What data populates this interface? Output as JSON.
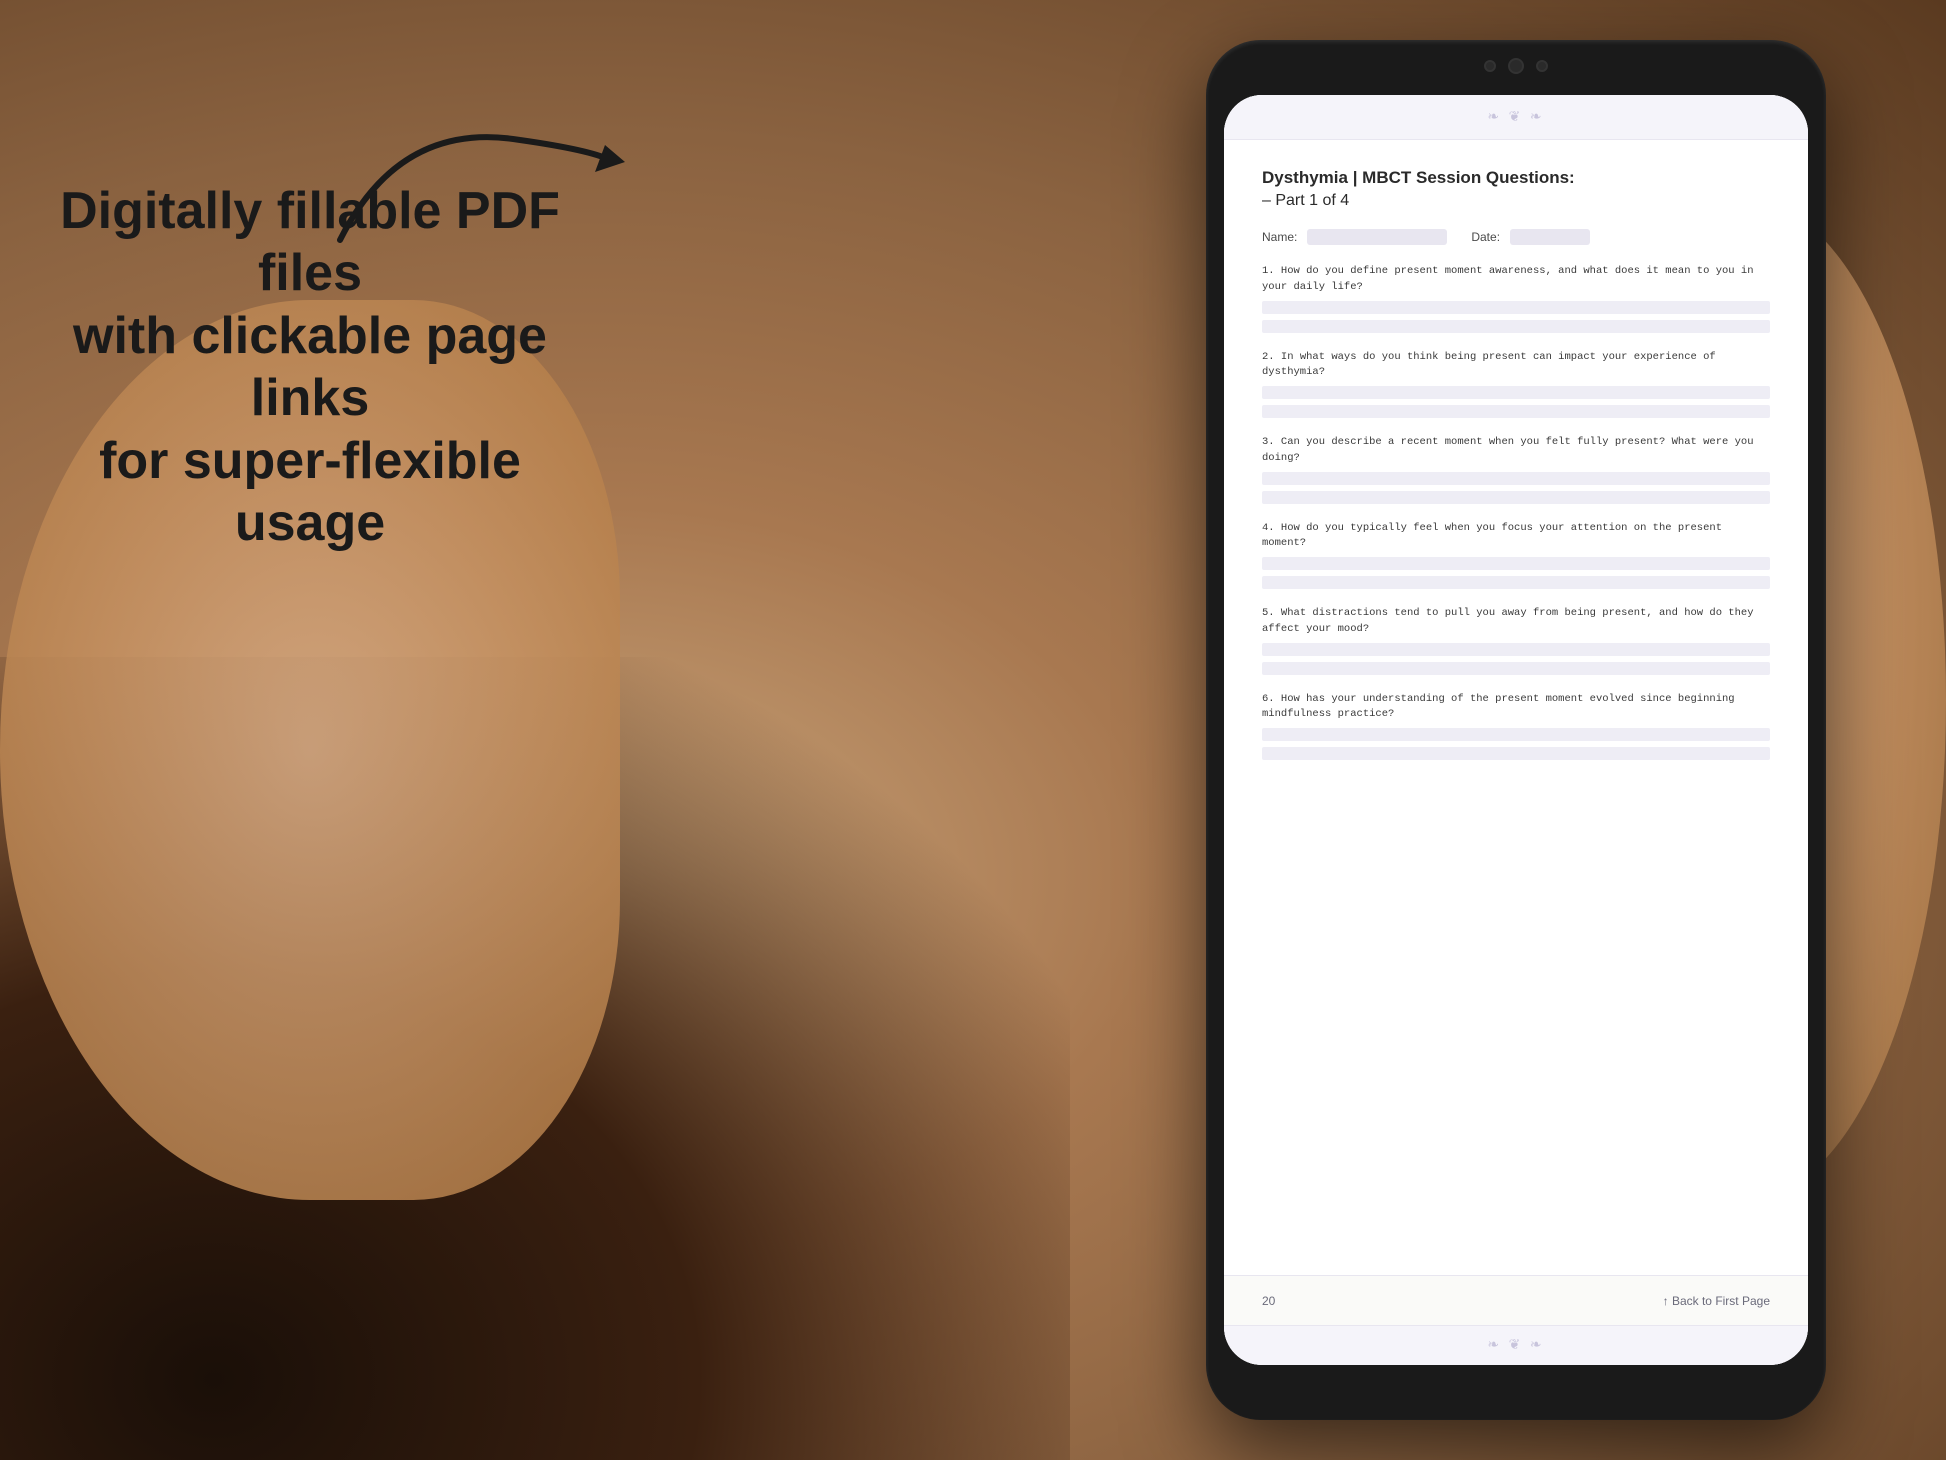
{
  "background": {
    "color": "#b8956a"
  },
  "left_text": {
    "line1": "Digitally fillable PDF files",
    "line2": "with clickable page links",
    "line3": "for super-flexible usage"
  },
  "arrow": {
    "description": "curved arrow pointing right toward tablet"
  },
  "tablet": {
    "screen": {
      "top_decoration": "❧ ❦ ❧",
      "bottom_decoration": "❧ ❦ ❧",
      "page_title": "Dysthymia | MBCT Session Questions:",
      "page_subtitle": "– Part 1 of 4",
      "name_label": "Name:",
      "date_label": "Date:",
      "questions": [
        {
          "number": "1.",
          "text": "How do you define present moment awareness, and what does it mean to you in your daily life?",
          "answer_lines": 2
        },
        {
          "number": "2.",
          "text": "In what ways do you think being present can impact your experience of dysthymia?",
          "answer_lines": 2
        },
        {
          "number": "3.",
          "text": "Can you describe a recent moment when you felt fully present? What were you doing?",
          "answer_lines": 2
        },
        {
          "number": "4.",
          "text": "How do you typically feel when you focus your attention on the present moment?",
          "answer_lines": 2
        },
        {
          "number": "5.",
          "text": "What distractions tend to pull you away from being present, and how do they affect your mood?",
          "answer_lines": 2
        },
        {
          "number": "6.",
          "text": "How has your understanding of the present moment evolved since beginning mindfulness practice?",
          "answer_lines": 2
        }
      ],
      "page_number": "20",
      "back_link": "↑ Back to First Page"
    }
  }
}
